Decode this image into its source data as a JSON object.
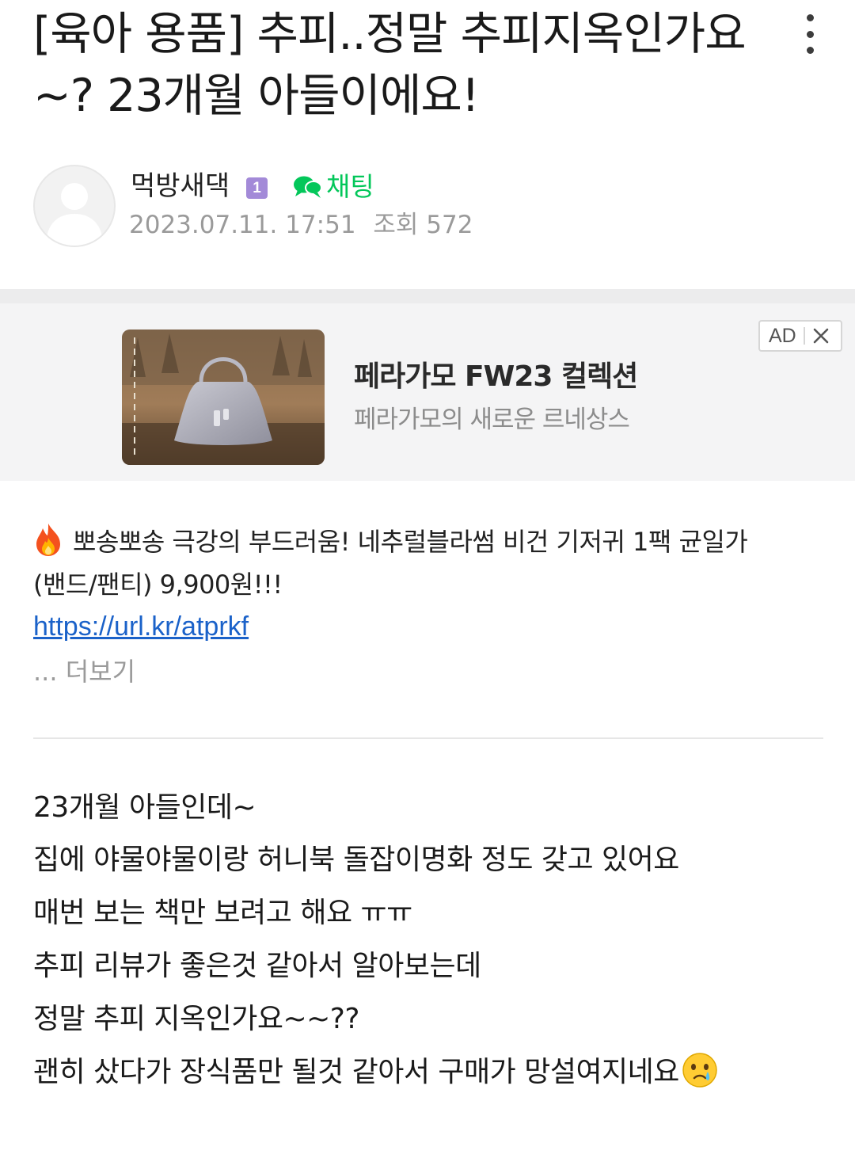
{
  "post": {
    "title": "[육아 용품] 추피..정말 추피지옥인가요~? 23개월 아들이에요!",
    "more_icon": "more-vertical-icon"
  },
  "author": {
    "name": "먹방새댁",
    "level": "1",
    "level_color": "#a38ad8",
    "chat_label": "채팅",
    "chat_color": "#03c75a",
    "date": "2023.07.11. 17:51",
    "views": "조회 572",
    "avatar_icon": "default-user-avatar-icon"
  },
  "ad": {
    "title": "페라가모 FW23 컬렉션",
    "description": "페라가모의 새로운 르네상스",
    "badge": "AD",
    "close_icon": "close-icon",
    "image": "handbag-product-image"
  },
  "promo": {
    "line1": "뽀송뽀송 극강의 부드러움! 네추럴블라썸 비건 기저귀 1팩 균일가",
    "line2": "(밴드/팬티) 9,900원!!!",
    "link": "https://url.kr/atprkf",
    "see_more": "... 더보기",
    "link_color": "#1b62c9"
  },
  "body": {
    "lines": [
      "23개월 아들인데~",
      "집에 야물야물이랑 허니북 돌잡이명화 정도 갖고 있어요",
      "매번 보는 책만 보려고 해요 ㅠㅠ",
      "추피 리뷰가 좋은것 같아서 알아보는데",
      "정말 추피 지옥인가요~~??",
      "괜히 샀다가 장식품만 될것 같아서 구매가 망설여지네요"
    ]
  }
}
